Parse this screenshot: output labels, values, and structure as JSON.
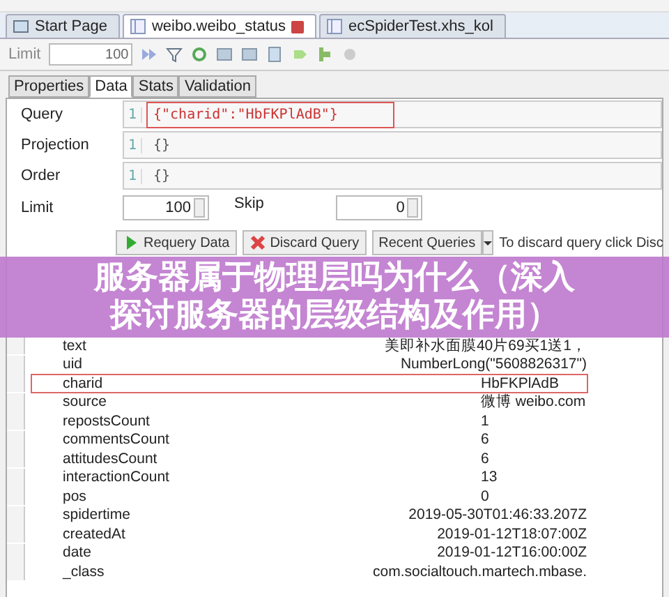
{
  "tabs": [
    {
      "label": "Start Page",
      "selected": false,
      "kind": "home"
    },
    {
      "label": "weibo.weibo_status",
      "selected": true,
      "kind": "collection"
    },
    {
      "label": "ecSpiderTest.xhs_kol",
      "selected": false,
      "kind": "collection"
    }
  ],
  "toolbar": {
    "limit_label": "Limit",
    "limit_value": "100"
  },
  "subtabs": [
    {
      "label": "Properties",
      "selected": false
    },
    {
      "label": "Data",
      "selected": true
    },
    {
      "label": "Stats",
      "selected": false
    },
    {
      "label": "Validation",
      "selected": false
    }
  ],
  "query_fields": [
    {
      "label": "Query",
      "line": "1",
      "value": "{\"charid\":\"HbFKPlAdB\"}",
      "highlighted": true
    },
    {
      "label": "Projection",
      "line": "1",
      "value": "{}",
      "highlighted": false
    },
    {
      "label": "Order",
      "line": "1",
      "value": "{}",
      "highlighted": false
    }
  ],
  "limit": {
    "label": "Limit",
    "value": "100"
  },
  "skip": {
    "label": "Skip",
    "value": "0"
  },
  "buttons": [
    {
      "label": "Requery Data",
      "kind": "run"
    },
    {
      "label": "Discard Query",
      "kind": "discard"
    },
    {
      "label": "Recent Queries",
      "kind": "menu"
    }
  ],
  "hint": "To discard query click Disc",
  "banner": {
    "title": "服务器属于物理层吗为什么（深入探讨服务器的层级结构及作用）"
  },
  "table": {
    "rows": [
      {
        "key": "text",
        "value": "美即补水面膜40片69买1送1，",
        "highlighted": false
      },
      {
        "key": "uid",
        "value": "NumberLong(\"5608826317\")",
        "highlighted": false
      },
      {
        "key": "charid",
        "value": "HbFKPlAdB",
        "highlighted": true
      },
      {
        "key": "source",
        "value": "微博 weibo.com",
        "highlighted": false
      },
      {
        "key": "repostsCount",
        "value": "1",
        "highlighted": false
      },
      {
        "key": "commentsCount",
        "value": "6",
        "highlighted": false
      },
      {
        "key": "attitudesCount",
        "value": "6",
        "highlighted": false
      },
      {
        "key": "interactionCount",
        "value": "13",
        "highlighted": false
      },
      {
        "key": "pos",
        "value": "0",
        "highlighted": false
      },
      {
        "key": "spidertime",
        "value": "2019-05-30T01:46:33.207Z",
        "highlighted": false
      },
      {
        "key": "createdAt",
        "value": "2019-01-12T18:07:00Z",
        "highlighted": false
      },
      {
        "key": "date",
        "value": "2019-01-12T16:00:00Z",
        "highlighted": false
      },
      {
        "key": "_class",
        "value": "com.socialtouch.martech.mbase.",
        "highlighted": false
      }
    ]
  }
}
